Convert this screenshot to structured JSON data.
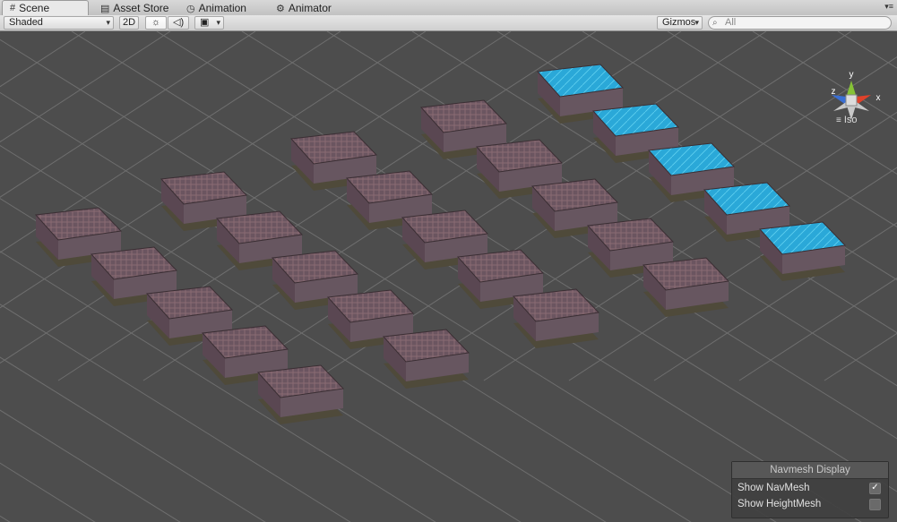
{
  "tabs": [
    {
      "label": "Scene",
      "icon": "grid-icon",
      "active": true
    },
    {
      "label": "Asset Store",
      "icon": "store-icon",
      "active": false
    },
    {
      "label": "Animation",
      "icon": "clock-icon",
      "active": false
    },
    {
      "label": "Animator",
      "icon": "animator-icon",
      "active": false
    }
  ],
  "toolbar": {
    "render_mode": "Shaded",
    "mode_2d": "2D",
    "lighting_icon": "sun-icon",
    "audio_icon": "speaker-icon",
    "effects_icon": "image-icon",
    "gizmos_label": "Gizmos",
    "search_placeholder": "All"
  },
  "gizmo": {
    "axes": [
      "x",
      "y",
      "z"
    ],
    "projection_label": "Iso",
    "colors": {
      "x": "#e0412a",
      "y": "#86c236",
      "z": "#3a6fd4"
    }
  },
  "navmesh_panel": {
    "title": "Navmesh Display",
    "rows": [
      {
        "label": "Show NavMesh",
        "checked": true
      },
      {
        "label": "Show HeightMesh",
        "checked": false
      }
    ]
  },
  "scene": {
    "background_color": "#4d4d4d",
    "grid_color": "#7a7a7a",
    "navmesh_color": "#2aa8d8",
    "object_color": "#6a5a62"
  }
}
